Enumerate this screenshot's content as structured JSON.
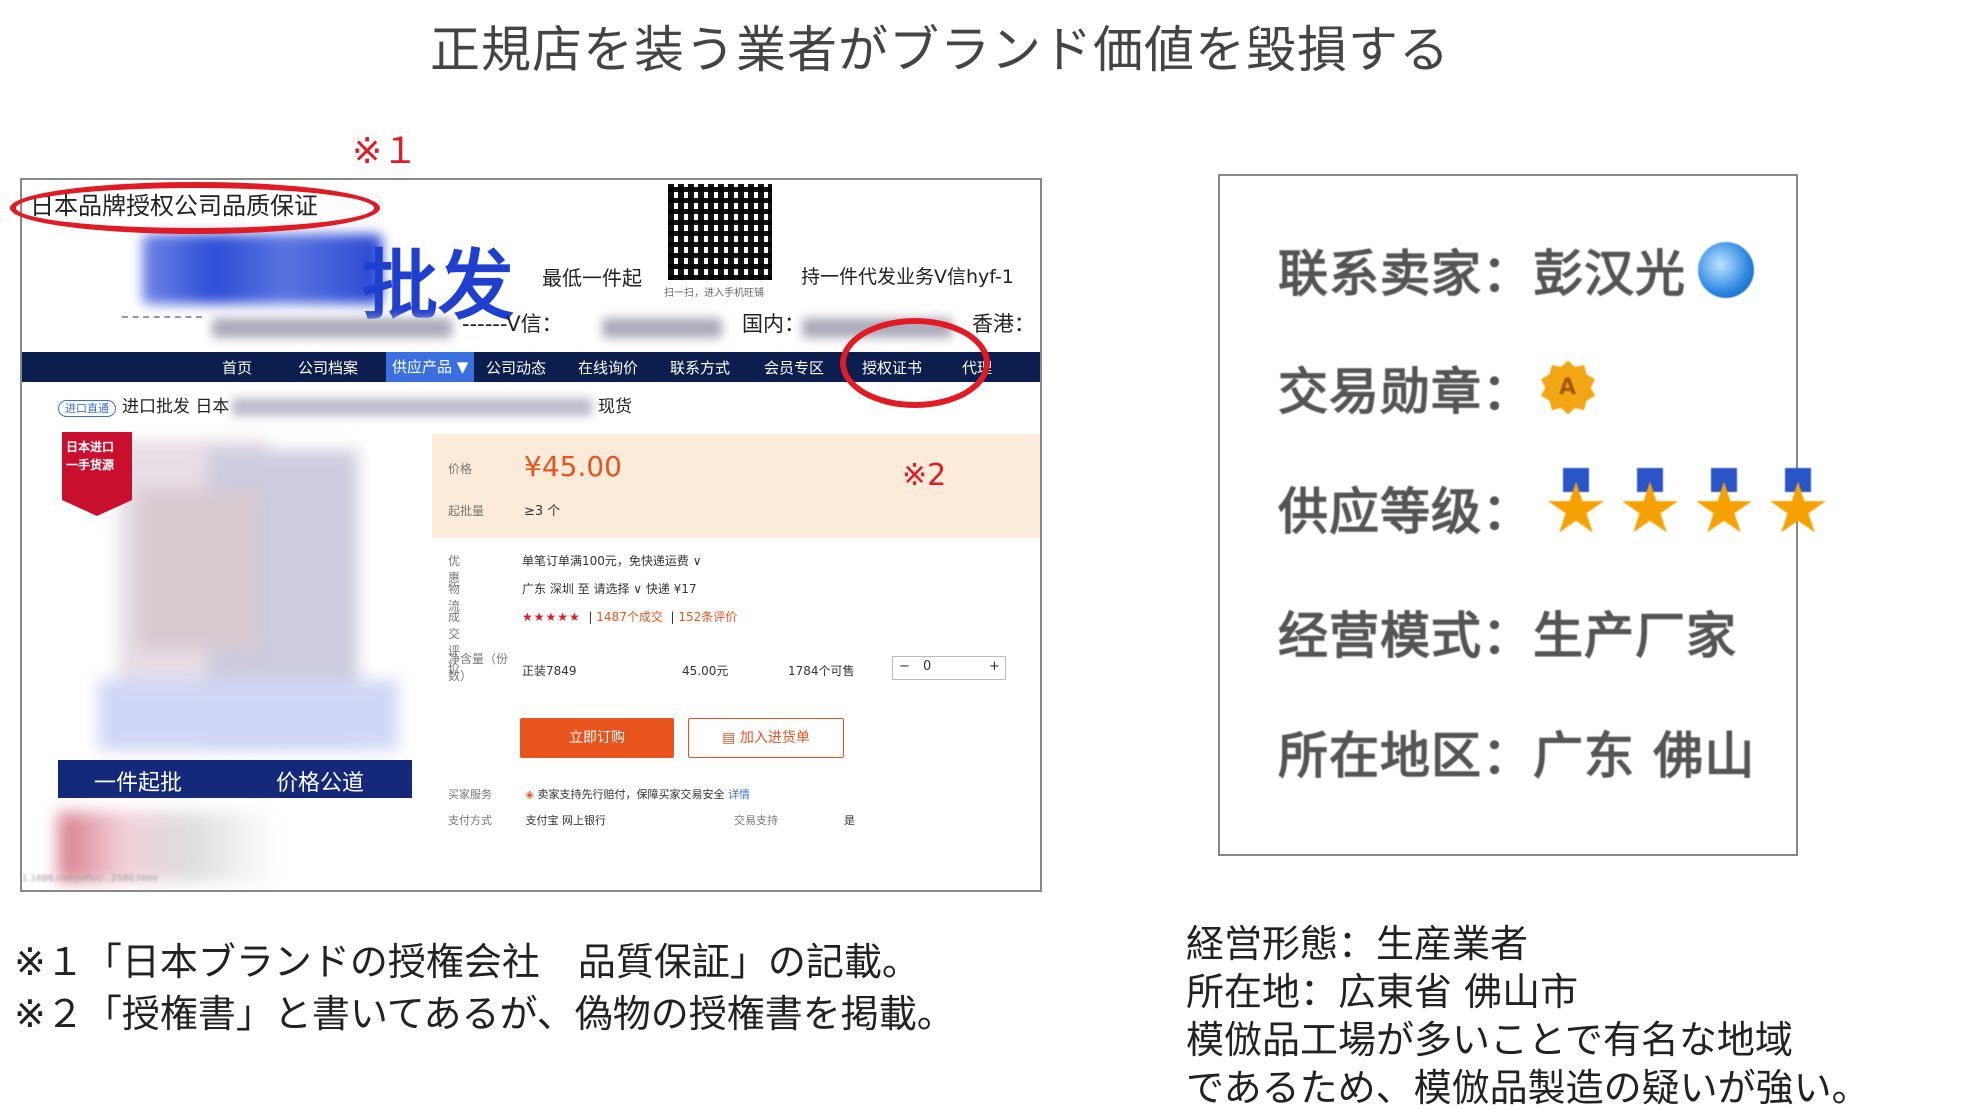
{
  "slide": {
    "title": "正規店を装う業者がブランド価値を毀損する",
    "mark1": "※１",
    "mark2": "※2"
  },
  "shop_screenshot": {
    "top_caption": "日本品牌授权公司品质保证",
    "brand_suffix": "批发",
    "slogan": "最低一件起",
    "slogan2": "支持一件代发业务V信hyf-1",
    "qr_caption": "扫一扫，进入手机旺铺",
    "contact": {
      "v_label": "------V信：",
      "domestic_label": "国内：",
      "hk_label": "香港："
    },
    "nav": [
      "首页",
      "公司档案",
      "供应产品 ▼",
      "公司动态",
      "在线询价",
      "联系方式",
      "会员专区",
      "授权证书",
      "代理"
    ],
    "breadcrumb": {
      "tag": "进口直通",
      "prefix": "进口批发 日本",
      "suffix": "现货"
    },
    "badge": [
      "日本进口",
      "一手货源"
    ],
    "image_bar": [
      "一件起批",
      "价格公道"
    ],
    "price_label": "价格",
    "price": "¥45.00",
    "min_qty_label": "起批量",
    "min_qty": "≥3 个",
    "info": [
      {
        "k": "优惠",
        "v": "单笔订单满100元，免快递运费 ∨"
      },
      {
        "k": "物流",
        "v": "广东 深圳  至  请选择  ∨   快递 ¥17"
      },
      {
        "k": "成交评价",
        "v_stars": "★★★★★",
        "v_deals": "1487个成交",
        "v_reviews": "152条评价"
      }
    ],
    "qty_row": {
      "label": "净含量（份数）",
      "model": "正装7849",
      "price": "45.00元",
      "stock": "1784个可售",
      "stepper_minus": "−",
      "stepper_value": "0",
      "stepper_plus": "+"
    },
    "buttons": {
      "order": "立即订购",
      "add_list": "加入进货单"
    },
    "services": [
      {
        "k": "买家服务",
        "v": "卖家支持先行赔付，保障买家交易安全",
        "link": "详情"
      },
      {
        "k": "支付方式",
        "v": "支付宝  网上银行",
        "k2": "交易支持",
        "v2": "是"
      }
    ],
    "url": "1.1688.com/offer/...2580.html"
  },
  "seller_panel": {
    "contact": "联系卖家：彭汉光",
    "badge": "交易勋章：",
    "badge_letter": "A",
    "supply": "供应等级：",
    "supply_stars": 4,
    "mode": "经营模式：生产厂家",
    "region": "所在地区：广东 佛山"
  },
  "notes": {
    "left": [
      "※１「日本ブランドの授権会社　品質保証」の記載。",
      "※２「授権書」と書いてあるが、偽物の授権書を掲載。"
    ],
    "right": [
      "経営形態：生産業者",
      "所在地：広東省 佛山市",
      "模倣品工場が多いことで有名な地域",
      "であるため、模倣品製造の疑いが強い。"
    ]
  }
}
